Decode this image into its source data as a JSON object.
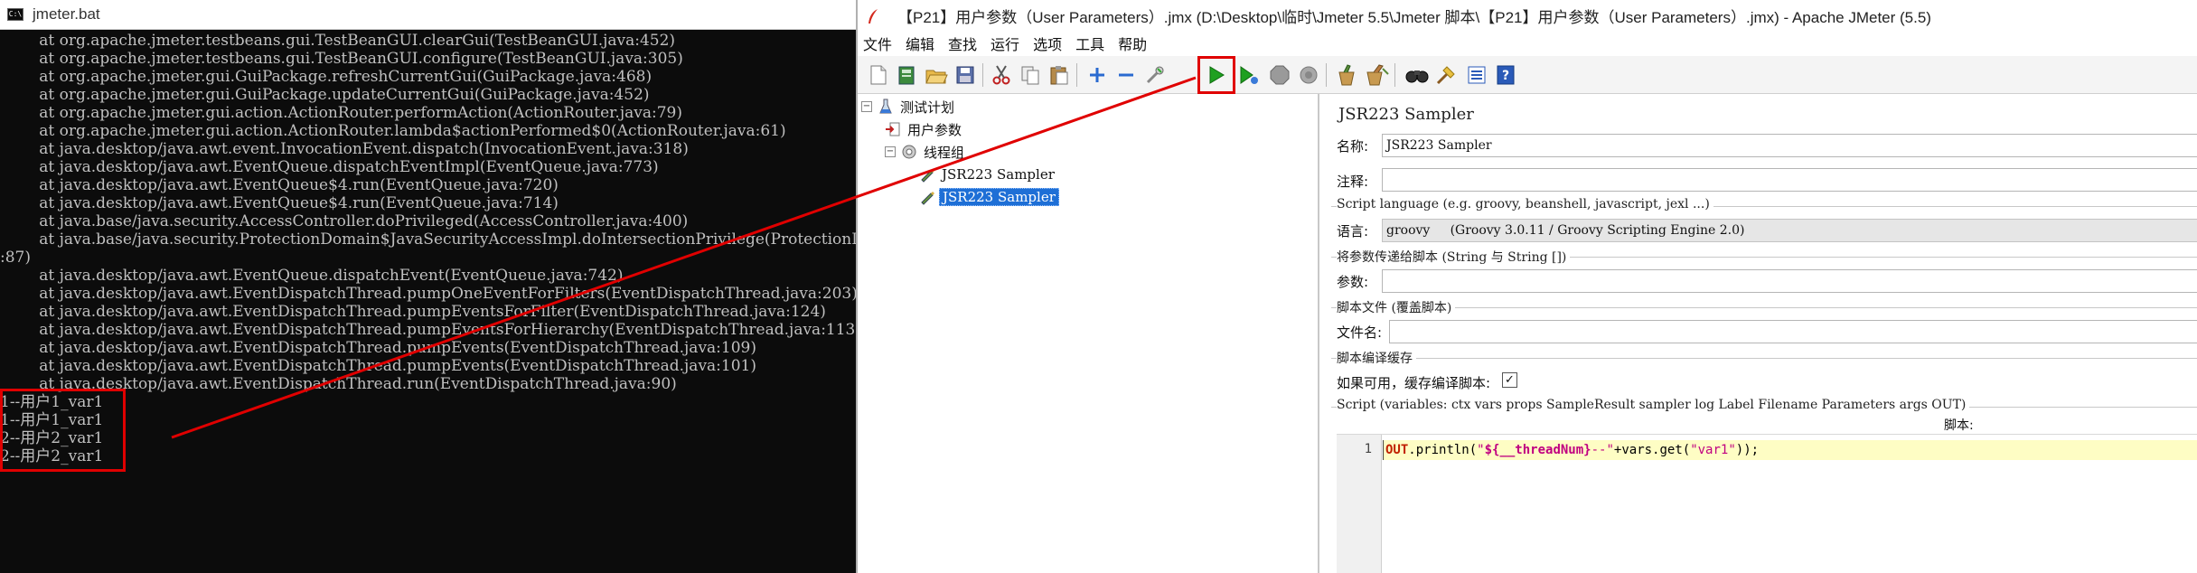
{
  "console": {
    "title": "jmeter.bat",
    "icon_label": "C:\\",
    "lines": [
      "        at org.apache.jmeter.testbeans.gui.TestBeanGUI.clearGui(TestBeanGUI.java:452)",
      "        at org.apache.jmeter.testbeans.gui.TestBeanGUI.configure(TestBeanGUI.java:305)",
      "        at org.apache.jmeter.gui.GuiPackage.refreshCurrentGui(GuiPackage.java:468)",
      "        at org.apache.jmeter.gui.GuiPackage.updateCurrentGui(GuiPackage.java:452)",
      "        at org.apache.jmeter.gui.action.ActionRouter.performAction(ActionRouter.java:79)",
      "        at org.apache.jmeter.gui.action.ActionRouter.lambda$actionPerformed$0(ActionRouter.java:61)",
      "        at java.desktop/java.awt.event.InvocationEvent.dispatch(InvocationEvent.java:318)",
      "        at java.desktop/java.awt.EventQueue.dispatchEventImpl(EventQueue.java:773)",
      "        at java.desktop/java.awt.EventQueue$4.run(EventQueue.java:720)",
      "        at java.desktop/java.awt.EventQueue$4.run(EventQueue.java:714)",
      "        at java.base/java.security.AccessController.doPrivileged(AccessController.java:400)",
      "        at java.base/java.security.ProtectionDomain$JavaSecurityAccessImpl.doIntersectionPrivilege(ProtectionDomain.java",
      ":87)",
      "        at java.desktop/java.awt.EventQueue.dispatchEvent(EventQueue.java:742)",
      "        at java.desktop/java.awt.EventDispatchThread.pumpOneEventForFilters(EventDispatchThread.java:203)",
      "        at java.desktop/java.awt.EventDispatchThread.pumpEventsForFilter(EventDispatchThread.java:124)",
      "        at java.desktop/java.awt.EventDispatchThread.pumpEventsForHierarchy(EventDispatchThread.java:113)",
      "        at java.desktop/java.awt.EventDispatchThread.pumpEvents(EventDispatchThread.java:109)",
      "        at java.desktop/java.awt.EventDispatchThread.pumpEvents(EventDispatchThread.java:101)",
      "        at java.desktop/java.awt.EventDispatchThread.run(EventDispatchThread.java:90)"
    ],
    "output_lines": [
      "1--用户1_var1",
      "1--用户1_var1",
      "2--用户2_var1",
      "2--用户2_var1"
    ]
  },
  "jmeter": {
    "title": "【P21】用户参数（User Parameters）.jmx (D:\\Desktop\\临时\\Jmeter 5.5\\Jmeter 脚本\\【P21】用户参数（User Parameters）.jmx) - Apache JMeter (5.5)",
    "menu": [
      "文件",
      "编辑",
      "查找",
      "运行",
      "选项",
      "工具",
      "帮助"
    ],
    "toolbar": [
      "new-icon",
      "templates-icon",
      "open-icon",
      "save-icon",
      "cut-icon",
      "copy-icon",
      "paste-icon",
      "expand-icon",
      "collapse-icon",
      "toggle-icon",
      "start-icon",
      "start-no-pauses-icon",
      "stop-icon",
      "shutdown-icon",
      "clear-icon",
      "clear-all-icon",
      "search-icon",
      "reset-search-icon",
      "function-helper-icon",
      "help-icon"
    ],
    "tree": {
      "test_plan": "测试计划",
      "user_params": "用户参数",
      "thread_group": "线程组",
      "sampler1": "JSR223 Sampler",
      "sampler2": "JSR223 Sampler"
    },
    "editor": {
      "title": "JSR223 Sampler",
      "name_label": "名称:",
      "name_value": "JSR223 Sampler",
      "comments_label": "注释:",
      "comments_value": "",
      "script_language_group": "Script language (e.g. groovy, beanshell, javascript, jexl ...)",
      "language_label": "语言:",
      "language_value": "groovy     (Groovy 3.0.11 / Groovy Scripting Engine 2.0)",
      "params_group": "将参数传递给脚本 (String 与 String [])",
      "params_label": "参数:",
      "params_value": "",
      "script_file_group": "脚本文件 (覆盖脚本)",
      "filename_label": "文件名:",
      "filename_value": "",
      "cache_group": "脚本编译缓存",
      "cache_label": "如果可用，缓存编译脚本:",
      "cache_checked": "✓",
      "script_group": "Script (variables: ctx vars props SampleResult sampler log Label Filename Parameters args OUT)",
      "script_label": "脚本:",
      "line_number": "1",
      "code": {
        "obj": "OUT",
        "call": ".println(",
        "str1_open": "\"",
        "str1_var": "${__threadNum}",
        "str1_rest": "--\"",
        "plus_vars": "+vars.get(",
        "str2": "\"var1\"",
        "end": "));"
      }
    }
  },
  "colors": {
    "console_bg": "#0c0c0c",
    "console_text": "#c0c0c0",
    "highlight_red": "#e00000",
    "tree_selection": "#1e6fd6",
    "run_green": "#1fa020"
  }
}
